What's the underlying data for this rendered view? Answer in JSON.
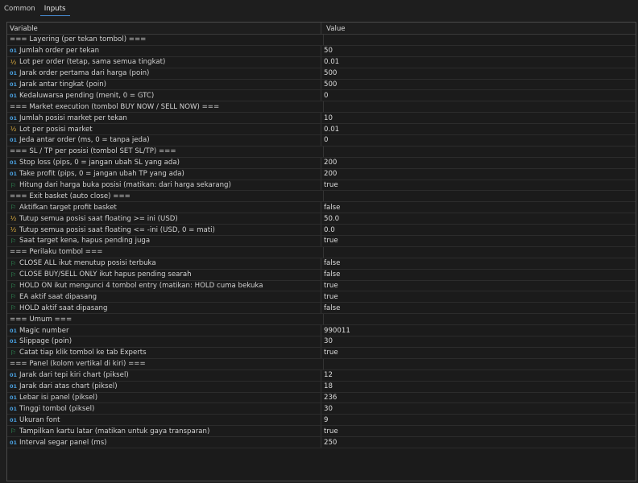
{
  "tabs": [
    "Common",
    "Inputs"
  ],
  "active_tab": 1,
  "table": {
    "col_variable": "Variable",
    "col_value": "Value",
    "rows": [
      {
        "type": "sep",
        "label": "=== Layering (per tekan tombol) ==="
      },
      {
        "type": "int",
        "label": "Jumlah order per tekan",
        "value": "50"
      },
      {
        "type": "dbl",
        "label": "Lot per order (tetap, sama semua tingkat)",
        "value": "0.01"
      },
      {
        "type": "int",
        "label": "Jarak order pertama dari harga (poin)",
        "value": "500"
      },
      {
        "type": "int",
        "label": "Jarak antar tingkat (poin)",
        "value": "500"
      },
      {
        "type": "int",
        "label": "Kedaluwarsa pending (menit, 0 = GTC)",
        "value": "0"
      },
      {
        "type": "sep",
        "label": "=== Market execution (tombol BUY NOW / SELL NOW) ==="
      },
      {
        "type": "int",
        "label": "Jumlah posisi market per tekan",
        "value": "10"
      },
      {
        "type": "dbl",
        "label": "Lot per posisi market",
        "value": "0.01"
      },
      {
        "type": "int",
        "label": "Jeda antar order (ms, 0 = tanpa jeda)",
        "value": "0"
      },
      {
        "type": "sep",
        "label": "=== SL / TP per posisi (tombol SET SL/TP) ==="
      },
      {
        "type": "int",
        "label": "Stop loss (pips, 0 = jangan ubah SL yang ada)",
        "value": "200"
      },
      {
        "type": "int",
        "label": "Take profit (pips, 0 = jangan ubah TP yang ada)",
        "value": "200"
      },
      {
        "type": "flag",
        "label": "Hitung dari harga buka posisi (matikan: dari harga sekarang)",
        "value": "true"
      },
      {
        "type": "sep",
        "label": "=== Exit basket (auto close) ==="
      },
      {
        "type": "flag",
        "label": "Aktifkan target profit basket",
        "value": "false"
      },
      {
        "type": "dbl",
        "label": "Tutup semua posisi saat floating >= ini (USD)",
        "value": "50.0"
      },
      {
        "type": "dbl",
        "label": "Tutup semua posisi saat floating <= -ini (USD, 0 = mati)",
        "value": "0.0"
      },
      {
        "type": "flag",
        "label": "Saat target kena, hapus pending juga",
        "value": "true"
      },
      {
        "type": "sep",
        "label": "=== Perilaku tombol ==="
      },
      {
        "type": "flag",
        "label": "CLOSE ALL ikut menutup posisi terbuka",
        "value": "false"
      },
      {
        "type": "flag",
        "label": "CLOSE BUY/SELL ONLY ikut hapus pending searah",
        "value": "false"
      },
      {
        "type": "flag",
        "label": "HOLD ON ikut mengunci 4 tombol entry (matikan: HOLD cuma bekuka",
        "value": "true"
      },
      {
        "type": "flag",
        "label": "EA aktif saat dipasang",
        "value": "true"
      },
      {
        "type": "flag",
        "label": "HOLD aktif saat dipasang",
        "value": "false"
      },
      {
        "type": "sep",
        "label": "=== Umum ==="
      },
      {
        "type": "int",
        "label": "Magic number",
        "value": "990011"
      },
      {
        "type": "int",
        "label": "Slippage (poin)",
        "value": "30"
      },
      {
        "type": "flag",
        "label": "Catat tiap klik tombol ke tab Experts",
        "value": "true"
      },
      {
        "type": "sep",
        "label": "=== Panel (kolom vertikal di kiri) ==="
      },
      {
        "type": "int",
        "label": "Jarak dari tepi kiri chart (piksel)",
        "value": "12"
      },
      {
        "type": "int",
        "label": "Jarak dari atas chart (piksel)",
        "value": "18"
      },
      {
        "type": "int",
        "label": "Lebar isi panel (piksel)",
        "value": "236"
      },
      {
        "type": "int",
        "label": "Tinggi tombol (piksel)",
        "value": "30"
      },
      {
        "type": "int",
        "label": "Ukuran font",
        "value": "9"
      },
      {
        "type": "flag",
        "label": "Tampilkan kartu latar (matikan untuk gaya transparan)",
        "value": "true"
      },
      {
        "type": "int",
        "label": "Interval segar panel (ms)",
        "value": "250"
      }
    ]
  },
  "icons": {
    "int": "01",
    "dbl": "½",
    "flag": "⚐"
  }
}
